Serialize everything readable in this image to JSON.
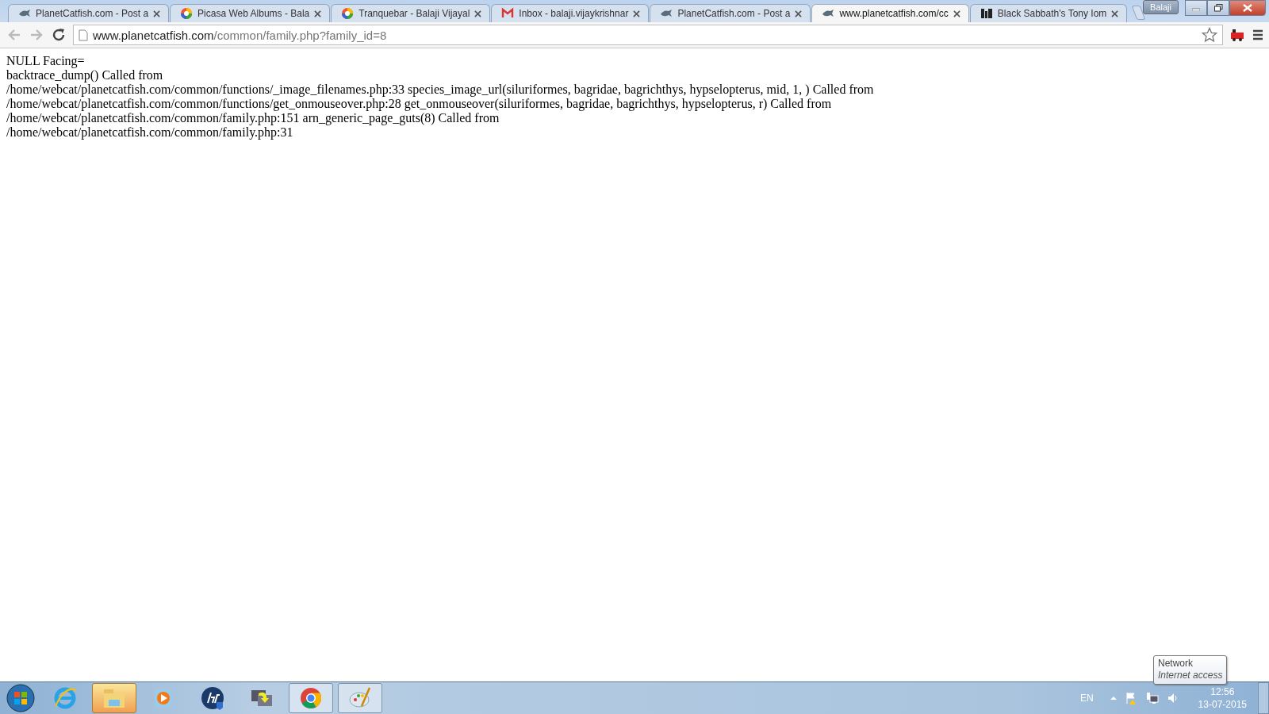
{
  "browser": {
    "tabs": [
      {
        "title": "PlanetCatfish.com - Post a",
        "kind": "fish",
        "selected": false
      },
      {
        "title": "Picasa Web Albums - Bala",
        "kind": "picasa",
        "selected": false
      },
      {
        "title": "Tranquebar - Balaji Vijayal",
        "kind": "picasa",
        "selected": false
      },
      {
        "title": "Inbox - balaji.vijaykrishnar",
        "kind": "gmail",
        "selected": false
      },
      {
        "title": "PlanetCatfish.com - Post a",
        "kind": "fish",
        "selected": false
      },
      {
        "title": "www.planetcatfish.com/cc",
        "kind": "fish",
        "selected": true
      },
      {
        "title": "Black Sabbath's Tony Iom",
        "kind": "bm",
        "selected": false
      }
    ],
    "user": "Balaji",
    "address": {
      "host": "www.planetcatfish.com",
      "path": "/common/family.php?family_id=8"
    }
  },
  "page": {
    "lines": [
      "NULL Facing=",
      "backtrace_dump() Called from",
      "/home/webcat/planetcatfish.com/common/functions/_image_filenames.php:33 species_image_url(siluriformes, bagridae, bagrichthys, hypselopterus, mid, 1, ) Called from",
      "/home/webcat/planetcatfish.com/common/functions/get_onmouseover.php:28 get_onmouseover(siluriformes, bagridae, bagrichthys, hypselopterus, r) Called from",
      "/home/webcat/planetcatfish.com/common/family.php:151 arn_generic_page_guts(8) Called from",
      "/home/webcat/planetcatfish.com/common/family.php:31"
    ]
  },
  "taskbar": {
    "apps": [
      {
        "kind": "ie",
        "open": false,
        "highlighted": false
      },
      {
        "kind": "explorer",
        "open": true,
        "highlighted": true
      },
      {
        "kind": "media",
        "open": false,
        "highlighted": false
      },
      {
        "kind": "hp",
        "open": false,
        "highlighted": false
      },
      {
        "kind": "transfer",
        "open": false,
        "highlighted": false
      },
      {
        "kind": "chrome",
        "open": true,
        "highlighted": false
      },
      {
        "kind": "paint",
        "open": true,
        "highlighted": false
      }
    ],
    "language": "EN",
    "time": "12:56",
    "date": "13-07-2015"
  },
  "tooltip": {
    "title": "Network",
    "subtitle": "Internet access"
  }
}
